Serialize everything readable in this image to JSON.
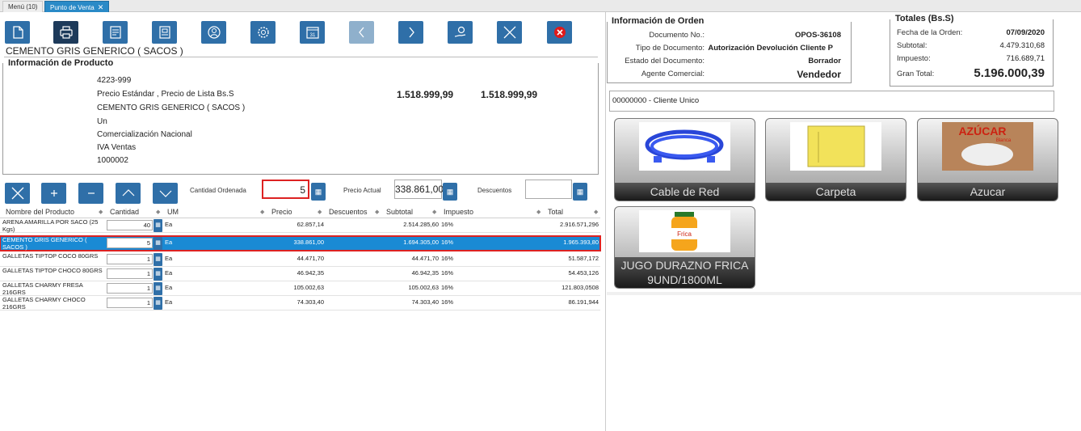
{
  "tabs": [
    {
      "label": "Menú (10)"
    },
    {
      "label": "Punto de Venta",
      "close": "✕"
    }
  ],
  "toolbar": {
    "icons": [
      "new-document-icon",
      "print-icon",
      "receipt-icon",
      "cash-register-icon",
      "customer-icon",
      "settings-icon",
      "calendar-icon",
      "previous-icon",
      "next-icon",
      "payment-icon",
      "close-icon",
      "cancel-icon"
    ],
    "calendar_day": "31"
  },
  "product": {
    "name": "CEMENTO GRIS GENERICO ( SACOS )",
    "info_title": "Información de Producto",
    "code": "4223-999",
    "price_list": "Precio Estándar , Precio de Lista Bs.S",
    "standard_price": "1.518.999,99",
    "list_price": "1.518.999,99",
    "description": "CEMENTO GRIS GENERICO ( SACOS )",
    "uom": "Un",
    "category": "Comercialización Nacional",
    "tax": "IVA Ventas",
    "code2": "1000002"
  },
  "controls": {
    "qty_label": "Cantidad Ordenada",
    "qty_value": "5",
    "price_label": "Precio Actual",
    "price_value": "338.861,00",
    "discount_label": "Descuentos",
    "discount_value": "",
    "calc_icon": "▦"
  },
  "table": {
    "headers": [
      "Nombre del Producto",
      "Cantidad",
      "UM",
      "Precio",
      "Descuentos",
      "Subtotal",
      "Impuesto",
      "Total"
    ],
    "rows": [
      {
        "name": "ARENA AMARILLA POR SACO (25 Kgs)",
        "qty": "40",
        "um": "Ea",
        "price": "62.857,14",
        "disc": "",
        "subtotal": "2.514.285,60",
        "tax": "16%",
        "total": "2.916.571,296",
        "selected": false
      },
      {
        "name": "CEMENTO GRIS GENERICO ( SACOS )",
        "qty": "5",
        "um": "Ea",
        "price": "338.861,00",
        "disc": "",
        "subtotal": "1.694.305,00",
        "tax": "16%",
        "total": "1.965.393,80",
        "selected": true
      },
      {
        "name": "GALLETAS TIPTOP COCO 80GRS",
        "qty": "1",
        "um": "Ea",
        "price": "44.471,70",
        "disc": "",
        "subtotal": "44.471,70",
        "tax": "16%",
        "total": "51.587,172",
        "selected": false
      },
      {
        "name": "GALLETAS TIPTOP CHOCO 80GRS",
        "qty": "1",
        "um": "Ea",
        "price": "46.942,35",
        "disc": "",
        "subtotal": "46.942,35",
        "tax": "16%",
        "total": "54.453,126",
        "selected": false
      },
      {
        "name": "GALLETAS CHARMY FRESA 216GRS",
        "qty": "1",
        "um": "Ea",
        "price": "105.002,63",
        "disc": "",
        "subtotal": "105.002,63",
        "tax": "16%",
        "total": "121.803,0508",
        "selected": false
      },
      {
        "name": "GALLETAS CHARMY CHOCO 216GRS",
        "qty": "1",
        "um": "Ea",
        "price": "74.303,40",
        "disc": "",
        "subtotal": "74.303,40",
        "tax": "16%",
        "total": "86.191,944",
        "selected": false
      }
    ]
  },
  "order": {
    "title": "Información de Orden",
    "doc_no_label": "Documento No.:",
    "doc_no": "OPOS-36108",
    "doc_type_label": "Tipo de Documento:",
    "doc_type": "Autorización Devolución Cliente P",
    "status_label": "Estado del Documento:",
    "status": "Borrador",
    "agent_label": "Agente Comercial:",
    "agent": "Vendedor"
  },
  "totals": {
    "title": "Totales (Bs.S)",
    "date_label": "Fecha de la Orden:",
    "date": "07/09/2020",
    "subtotal_label": "Subtotal:",
    "subtotal": "4.479.310,68",
    "tax_label": "Impuesto:",
    "tax": "716.689,71",
    "grand_label": "Gran Total:",
    "grand": "5.196.000,39"
  },
  "customer": "00000000 - Cliente Unico",
  "products": [
    {
      "label": "Cable de Red",
      "image": "network-cable-image"
    },
    {
      "label": "Carpeta",
      "image": "yellow-folder-image"
    },
    {
      "label": "Azucar",
      "image": "sugar-bag-image",
      "image_text": "AZÚCAR",
      "image_sub": "Blanca"
    },
    {
      "label": "JUGO DURAZNO FRICA 9UND/1800ML",
      "image": "juice-bottle-image",
      "image_text": "Frica"
    }
  ],
  "colors": {
    "accent": "#2f6fa8",
    "selected_row": "#1a8ad4",
    "highlight": "#d22222"
  }
}
